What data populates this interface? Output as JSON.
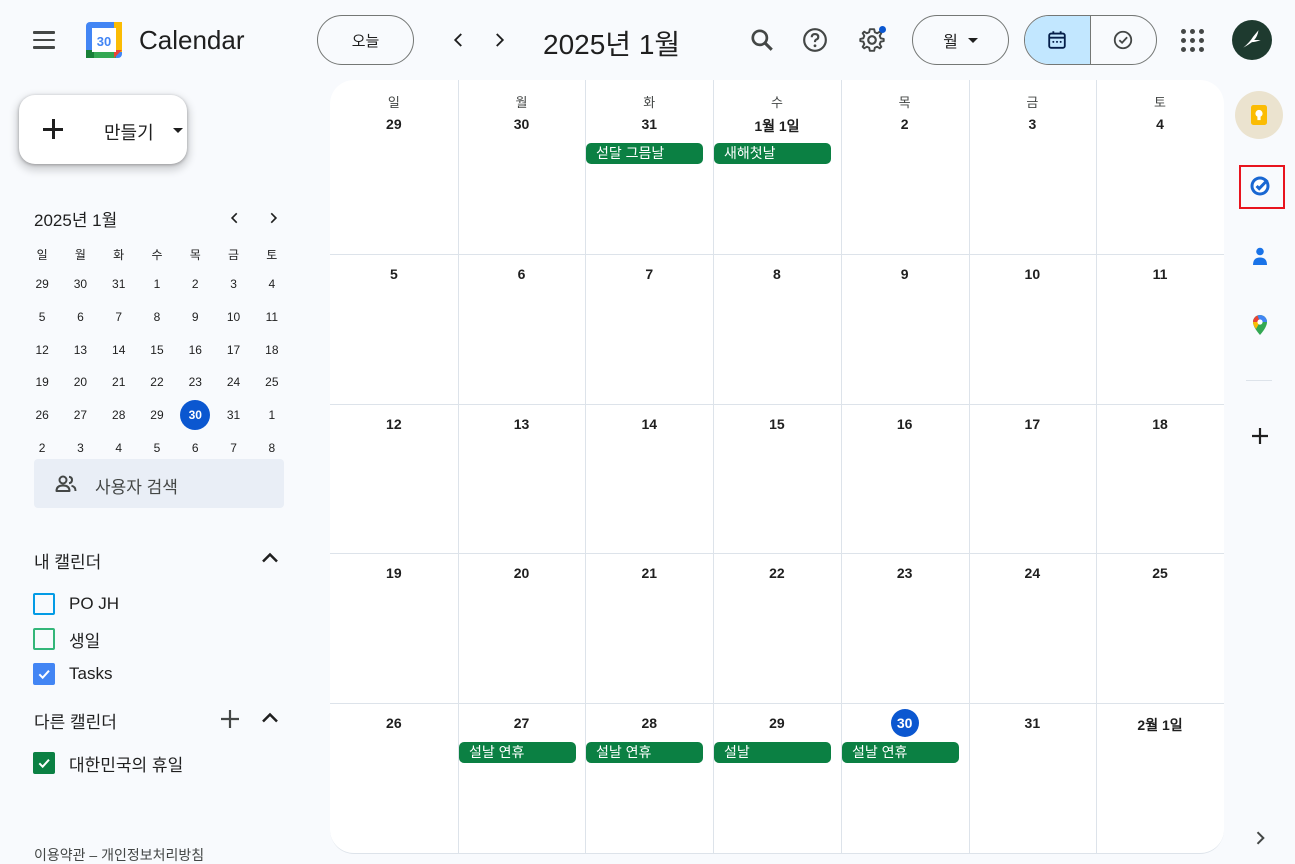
{
  "header": {
    "app_title": "Calendar",
    "logo_number": "30",
    "today_label": "오늘",
    "month_title": "2025년 1월",
    "view_label": "월"
  },
  "sidebar": {
    "create_label": "만들기",
    "mini_cal": {
      "title": "2025년 1월",
      "weekdays": [
        "일",
        "월",
        "화",
        "수",
        "목",
        "금",
        "토"
      ],
      "weeks": [
        [
          "29",
          "30",
          "31",
          "1",
          "2",
          "3",
          "4"
        ],
        [
          "5",
          "6",
          "7",
          "8",
          "9",
          "10",
          "11"
        ],
        [
          "12",
          "13",
          "14",
          "15",
          "16",
          "17",
          "18"
        ],
        [
          "19",
          "20",
          "21",
          "22",
          "23",
          "24",
          "25"
        ],
        [
          "26",
          "27",
          "28",
          "29",
          "30",
          "31",
          "1"
        ],
        [
          "2",
          "3",
          "4",
          "5",
          "6",
          "7",
          "8"
        ]
      ],
      "today": "30"
    },
    "people_search_placeholder": "사용자 검색",
    "my_calendars_title": "내 캘린더",
    "my_calendars": [
      {
        "name": "PO JH",
        "checked": false,
        "color": "#039be5"
      },
      {
        "name": "생일",
        "checked": false,
        "color": "#33b679"
      },
      {
        "name": "Tasks",
        "checked": true,
        "color": "#4285f4"
      }
    ],
    "other_calendars_title": "다른 캘린더",
    "other_calendars": [
      {
        "name": "대한민국의 휴일",
        "checked": true,
        "color": "#0b8043"
      }
    ],
    "footer": "이용약관 – 개인정보처리방침"
  },
  "month": {
    "weekdays": [
      "일",
      "월",
      "화",
      "수",
      "목",
      "금",
      "토"
    ],
    "weeks": [
      [
        "29",
        "30",
        "31",
        "1월 1일",
        "2",
        "3",
        "4"
      ],
      [
        "5",
        "6",
        "7",
        "8",
        "9",
        "10",
        "11"
      ],
      [
        "12",
        "13",
        "14",
        "15",
        "16",
        "17",
        "18"
      ],
      [
        "19",
        "20",
        "21",
        "22",
        "23",
        "24",
        "25"
      ],
      [
        "26",
        "27",
        "28",
        "29",
        "30",
        "31",
        "2월 1일"
      ]
    ],
    "events": [
      {
        "week": 0,
        "day": 2,
        "title": "섣달 그믐날"
      },
      {
        "week": 0,
        "day": 3,
        "title": "새해첫날"
      },
      {
        "week": 4,
        "day": 1,
        "title": "설날 연휴"
      },
      {
        "week": 4,
        "day": 2,
        "title": "설날 연휴"
      },
      {
        "week": 4,
        "day": 3,
        "title": "설날"
      },
      {
        "week": 4,
        "day": 4,
        "title": "설날 연휴"
      }
    ],
    "today": {
      "week": 4,
      "day": 4
    },
    "event_color": "#0b8043"
  },
  "right_rail": [
    "keep-icon",
    "tasks-icon",
    "contacts-icon",
    "maps-icon",
    "add-icon"
  ],
  "colors": {
    "accent": "#0b57d0",
    "selected_toggle": "#c2e7ff",
    "highlight": "#e8141e"
  }
}
